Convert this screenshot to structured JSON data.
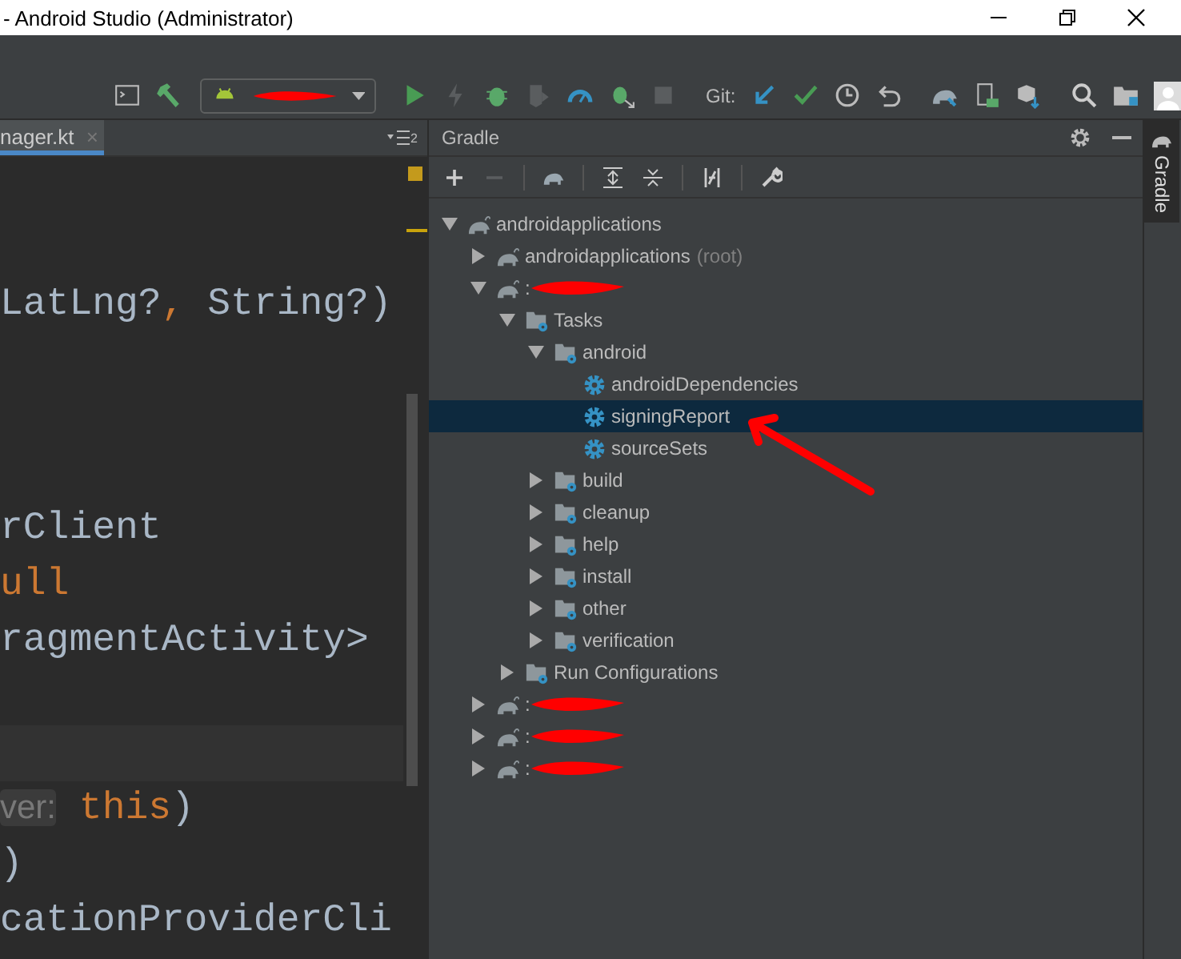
{
  "window": {
    "title": "- Android Studio (Administrator)"
  },
  "toolbar": {
    "vcs_label": "Git:"
  },
  "editor": {
    "tab": {
      "label": "nager.kt",
      "close": "×",
      "selected": true
    },
    "tab_count": "2",
    "lines": [
      {
        "kind": "code",
        "parts": [
          {
            "text": "LatLng?",
            "kind": "plain"
          },
          {
            "text": ",",
            "kind": "keyword"
          },
          {
            "text": " String?)",
            "kind": "plain"
          }
        ]
      },
      {
        "kind": "blank"
      },
      {
        "kind": "blank"
      },
      {
        "kind": "blank"
      },
      {
        "kind": "code",
        "parts": [
          {
            "text": "rClient",
            "kind": "plain"
          }
        ]
      },
      {
        "kind": "code",
        "parts": [
          {
            "text": "ull",
            "kind": "keyword"
          }
        ]
      },
      {
        "kind": "code",
        "parts": [
          {
            "text": "ragmentActivity>",
            "kind": "plain"
          }
        ]
      },
      {
        "kind": "blank"
      },
      {
        "kind": "current_blank"
      },
      {
        "kind": "code",
        "parts": [
          {
            "text": "ver:",
            "kind": "hint"
          },
          {
            "text": " this",
            "kind": "keyword"
          },
          {
            "text": ")",
            "kind": "plain"
          }
        ]
      },
      {
        "kind": "code",
        "parts": [
          {
            "text": ")",
            "kind": "plain"
          }
        ]
      },
      {
        "kind": "code",
        "parts": [
          {
            "text": "cationProviderCli",
            "kind": "plain"
          }
        ]
      }
    ]
  },
  "gradle_panel": {
    "title": "Gradle",
    "tree": [
      {
        "label": "androidapplications",
        "kind": "elephant",
        "expanded": true,
        "selected": false,
        "redacted": false,
        "children": [
          {
            "label": "androidapplications",
            "suffix": "(root)",
            "kind": "elephant",
            "expanded": false,
            "selected": false,
            "redacted": false
          },
          {
            "label": ":",
            "kind": "elephant",
            "expanded": true,
            "selected": false,
            "redacted": true,
            "children": [
              {
                "label": "Tasks",
                "kind": "folder",
                "expanded": true,
                "selected": false,
                "redacted": false,
                "children": [
                  {
                    "label": "android",
                    "kind": "folder",
                    "expanded": true,
                    "selected": false,
                    "redacted": false,
                    "children": [
                      {
                        "label": "androidDependencies",
                        "kind": "task",
                        "selected": false,
                        "redacted": false
                      },
                      {
                        "label": "signingReport",
                        "kind": "task",
                        "selected": true,
                        "redacted": false
                      },
                      {
                        "label": "sourceSets",
                        "kind": "task",
                        "selected": false,
                        "redacted": false
                      }
                    ]
                  },
                  {
                    "label": "build",
                    "kind": "folder",
                    "expanded": false,
                    "selected": false,
                    "redacted": false
                  },
                  {
                    "label": "cleanup",
                    "kind": "folder",
                    "expanded": false,
                    "selected": false,
                    "redacted": false
                  },
                  {
                    "label": "help",
                    "kind": "folder",
                    "expanded": false,
                    "selected": false,
                    "redacted": false
                  },
                  {
                    "label": "install",
                    "kind": "folder",
                    "expanded": false,
                    "selected": false,
                    "redacted": false
                  },
                  {
                    "label": "other",
                    "kind": "folder",
                    "expanded": false,
                    "selected": false,
                    "redacted": false
                  },
                  {
                    "label": "verification",
                    "kind": "folder",
                    "expanded": false,
                    "selected": false,
                    "redacted": false
                  }
                ]
              },
              {
                "label": "Run Configurations",
                "kind": "folder",
                "expanded": false,
                "selected": false,
                "redacted": false
              }
            ]
          },
          {
            "label": ":",
            "kind": "elephant",
            "expanded": false,
            "selected": false,
            "redacted": true
          },
          {
            "label": ":",
            "kind": "elephant",
            "expanded": false,
            "selected": false,
            "redacted": true
          },
          {
            "label": ":",
            "kind": "elephant",
            "expanded": false,
            "selected": false,
            "redacted": true
          }
        ]
      }
    ]
  },
  "side_strip": {
    "label": "Gradle"
  }
}
